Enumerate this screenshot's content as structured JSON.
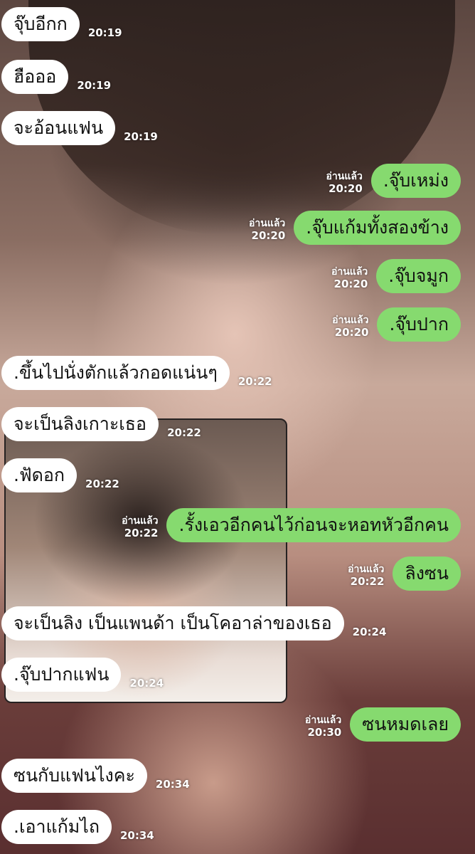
{
  "chat": {
    "messages": [
      {
        "side": "in",
        "text": "จุ๊บอีกก",
        "time": "20:19"
      },
      {
        "side": "in",
        "text": "ฮือออ",
        "time": "20:19"
      },
      {
        "side": "in",
        "text": "จะอ้อนแฟน",
        "time": "20:19"
      },
      {
        "side": "out",
        "text": ".จุ๊บเหม่ง",
        "time": "20:20",
        "read": "อ่านแล้ว"
      },
      {
        "side": "out",
        "text": ".จุ๊บแก้มทั้งสองข้าง",
        "time": "20:20",
        "read": "อ่านแล้ว"
      },
      {
        "side": "out",
        "text": ".จุ๊บจมูก",
        "time": "20:20",
        "read": "อ่านแล้ว"
      },
      {
        "side": "out",
        "text": ".จุ๊บปาก",
        "time": "20:20",
        "read": "อ่านแล้ว"
      },
      {
        "side": "in",
        "text": ".ขึ้นไปนั่งตักแล้วกอดแน่นๆ",
        "time": "20:22"
      },
      {
        "side": "in",
        "text": "จะเป็นลิงเกาะเธอ",
        "time": "20:22"
      },
      {
        "side": "in",
        "text": ".ฟัดอก",
        "time": "20:22"
      },
      {
        "side": "out",
        "text": ".รั้งเอวอีกคนไว้ก่อนจะหอทหัวอีกคน",
        "time": "20:22",
        "read": "อ่านแล้ว"
      },
      {
        "side": "out",
        "text": "ลิงซน",
        "time": "20:22",
        "read": "อ่านแล้ว"
      },
      {
        "side": "in",
        "text": "จะเป็นลิง เป็นแพนด้า เป็นโคอาล่าของเธอ",
        "time": "20:24"
      },
      {
        "side": "in",
        "text": ".จุ๊บปากแฟน",
        "time": "20:24"
      },
      {
        "side": "out",
        "text": "ซนหมดเลย",
        "time": "20:30",
        "read": "อ่านแล้ว"
      },
      {
        "side": "in",
        "text": "ซนกับแฟนไงคะ",
        "time": "20:34"
      },
      {
        "side": "in",
        "text": ".เอาแก้มไถ",
        "time": "20:34"
      }
    ]
  },
  "colors": {
    "incoming_bubble": "#ffffff",
    "outgoing_bubble": "#86da6f",
    "meta_text": "#ffffff"
  }
}
